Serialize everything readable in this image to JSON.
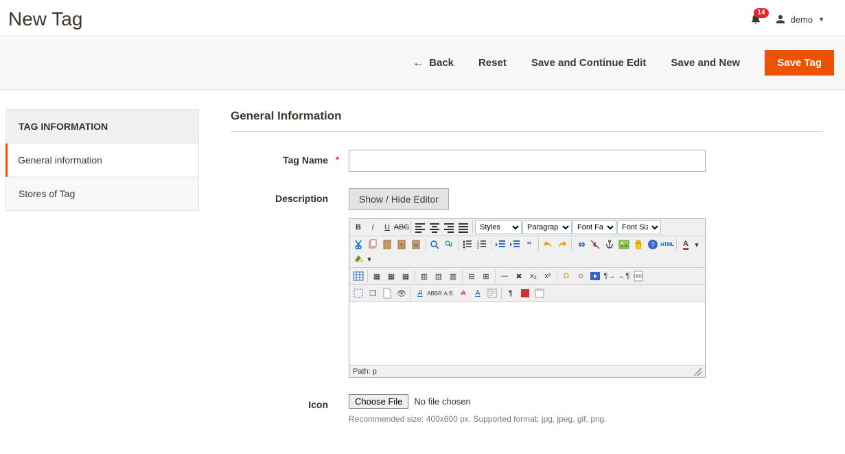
{
  "header": {
    "title": "New Tag",
    "notifications_count": "14",
    "username": "demo"
  },
  "actions": {
    "back": "Back",
    "reset": "Reset",
    "save_continue": "Save and Continue Edit",
    "save_new": "Save and New",
    "save": "Save Tag"
  },
  "sidebar": {
    "panel_title": "TAG INFORMATION",
    "tabs": [
      {
        "label": "General information",
        "active": true
      },
      {
        "label": "Stores of Tag",
        "active": false
      }
    ]
  },
  "form": {
    "section_title": "General Information",
    "tag_name_label": "Tag Name",
    "tag_name_value": "",
    "description_label": "Description",
    "toggle_editor_label": "Show / Hide Editor",
    "icon_label": "Icon",
    "file_button": "Choose File",
    "file_status": "No file chosen",
    "file_hint": "Recommended size: 400x600 px. Supported format: jpg, jpeg, gif, png."
  },
  "editor": {
    "styles_label": "Styles",
    "paragraph_label": "Paragraph",
    "font_family_label": "Font Family",
    "font_size_label": "Font Size",
    "path_label": "Path: p"
  }
}
